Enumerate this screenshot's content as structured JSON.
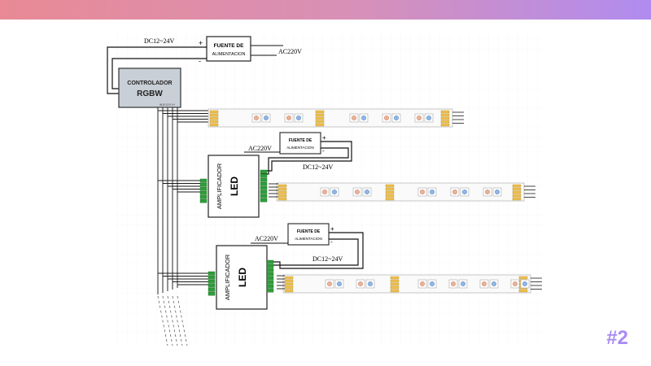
{
  "slide_number": "#2",
  "colors": {
    "header_gradient_start": "#e98a95",
    "header_gradient_end": "#b08cf0",
    "slide_number": "#a98bf5",
    "wire": "#1a1a1a",
    "led_connector": "#f2c14e",
    "amplifier_terminal": "#2e9e3a"
  },
  "controller": {
    "line1": "CONTROLADOR",
    "line2": "RGBW",
    "port_label": "W B G R V+"
  },
  "power_supply": {
    "line1": "FUENTE DE",
    "line2": "ALIMENTACION",
    "dc_label": "DC12~24V",
    "ac_label": "AC220V",
    "plus": "+",
    "minus": "-"
  },
  "amplifier": {
    "line1": "AMPLIFICADOR",
    "line2": "LED"
  }
}
